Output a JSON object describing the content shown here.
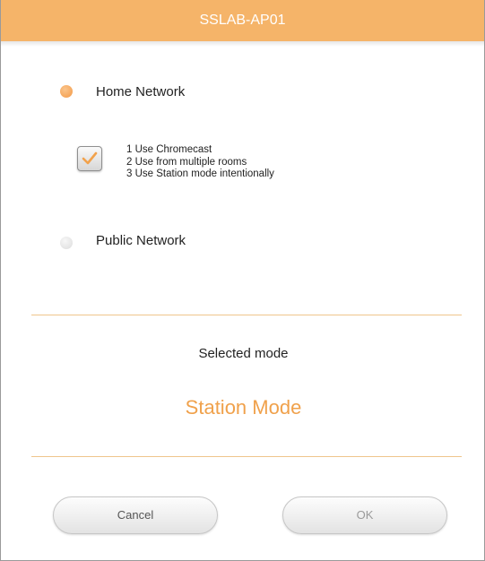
{
  "dialog": {
    "title": "SSLAB-AP01"
  },
  "options": {
    "home_network": {
      "label": "Home Network",
      "selected": true
    },
    "public_network": {
      "label": "Public Network",
      "selected": false
    }
  },
  "usage_checkbox": {
    "checked": true,
    "lines": [
      "1 Use Chromecast",
      "2 Use from multiple rooms",
      "3 Use Station mode intentionally"
    ]
  },
  "mode": {
    "caption": "Selected mode",
    "value": "Station Mode"
  },
  "buttons": {
    "cancel": "Cancel",
    "ok": "OK"
  },
  "colors": {
    "accent": "#f5b469",
    "mode_text": "#f0a14b",
    "divider": "#efc58c"
  }
}
